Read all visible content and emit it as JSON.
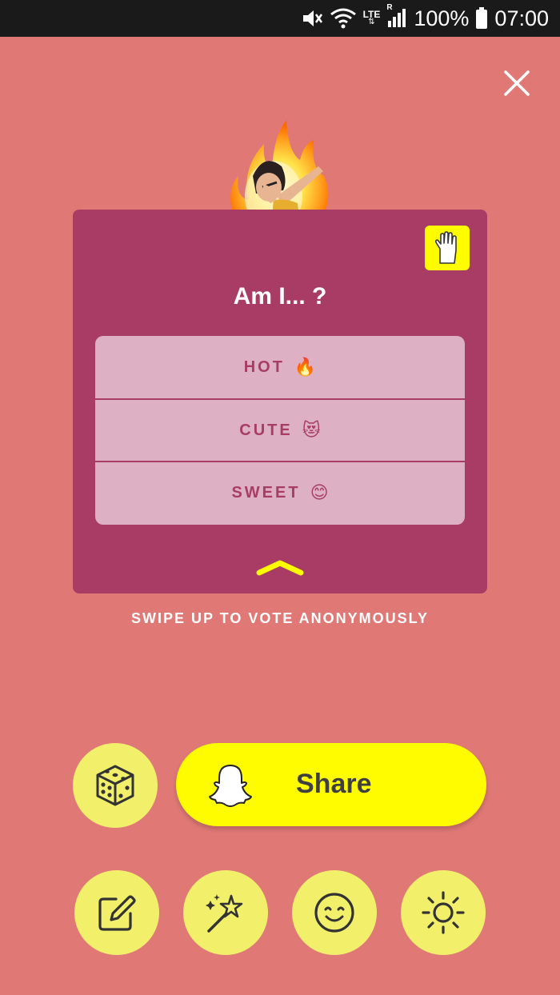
{
  "status_bar": {
    "network_label": "LTE",
    "roaming_label": "R",
    "battery": "100%",
    "time": "07:00"
  },
  "card": {
    "question": "Am I... ?",
    "options": [
      {
        "label": "HOT",
        "emoji": "🔥"
      },
      {
        "label": "CUTE",
        "emoji": "😻"
      },
      {
        "label": "SWEET",
        "emoji": "😊"
      }
    ]
  },
  "swipe_hint": "SWIPE UP TO VOTE ANONYMOUSLY",
  "share": {
    "label": "Share"
  },
  "icons": {
    "close": "close-icon",
    "hand": "raised-hand-icon",
    "dice": "dice-icon",
    "edit": "edit-icon",
    "magic": "magic-wand-icon",
    "emoji": "smiley-icon",
    "brightness": "sun-icon",
    "ghost": "snapchat-ghost-icon"
  },
  "colors": {
    "background": "#e07976",
    "card": "#a83c64",
    "option_bg": "#ddb1c3",
    "accent_yellow": "#fffc00",
    "tool_button": "#f2f06b"
  }
}
